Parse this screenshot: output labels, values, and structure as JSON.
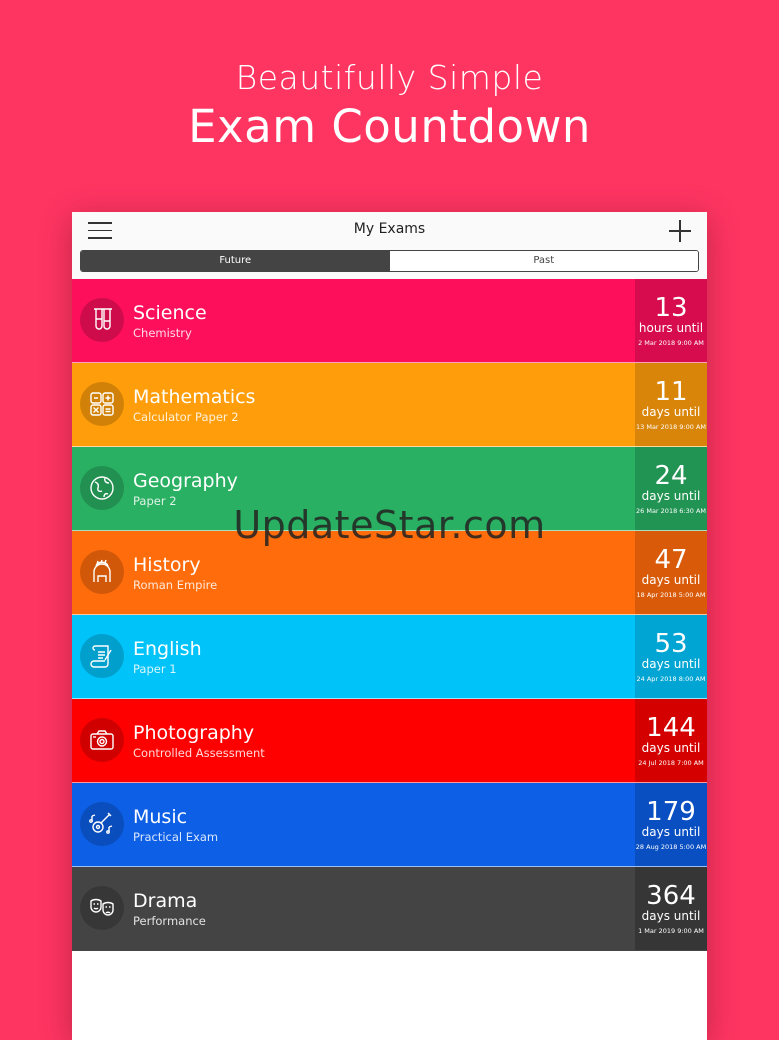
{
  "hero": {
    "line1": "Beautifully Simple",
    "line2": "Exam Countdown"
  },
  "navbar": {
    "title": "My Exams"
  },
  "segments": [
    {
      "label": "Future",
      "active": true
    },
    {
      "label": "Past",
      "active": false
    }
  ],
  "exams": [
    {
      "subject": "Science",
      "detail": "Chemistry",
      "count": "13",
      "unit": "hours until",
      "date": "2 Mar 2018 9:00 AM",
      "color": "#fd0f5c",
      "box_color": "#d60c4f",
      "icon": "test-tubes-icon"
    },
    {
      "subject": "Mathematics",
      "detail": "Calculator Paper 2",
      "count": "11",
      "unit": "days until",
      "date": "13 Mar 2018 9:00 AM",
      "color": "#ff9e0a",
      "box_color": "#d98509",
      "icon": "calculator-icon"
    },
    {
      "subject": "Geography",
      "detail": "Paper 2",
      "count": "24",
      "unit": "days until",
      "date": "26 Mar 2018 6:30 AM",
      "color": "#29b062",
      "box_color": "#219352",
      "icon": "globe-icon"
    },
    {
      "subject": "History",
      "detail": "Roman Empire",
      "count": "47",
      "unit": "days until",
      "date": "18 Apr 2018 5:00 AM",
      "color": "#ff6c0b",
      "box_color": "#d95b09",
      "icon": "roman-helmet-icon"
    },
    {
      "subject": "English",
      "detail": "Paper 1",
      "count": "53",
      "unit": "days until",
      "date": "24 Apr 2018 8:00 AM",
      "color": "#00c3f9",
      "box_color": "#00a5d3",
      "icon": "scroll-quill-icon"
    },
    {
      "subject": "Photography",
      "detail": "Controlled Assessment",
      "count": "144",
      "unit": "days until",
      "date": "24 Jul 2018 7:00 AM",
      "color": "#ff0000",
      "box_color": "#d40000",
      "icon": "camera-icon"
    },
    {
      "subject": "Music",
      "detail": "Practical Exam",
      "count": "179",
      "unit": "days until",
      "date": "28 Aug 2018 5:00 AM",
      "color": "#0d5fe6",
      "box_color": "#0a4fc2",
      "icon": "guitar-notes-icon"
    },
    {
      "subject": "Drama",
      "detail": "Performance",
      "count": "364",
      "unit": "days until",
      "date": "1 Mar 2019 9:00 AM",
      "color": "#444444",
      "box_color": "#363636",
      "icon": "theatre-masks-icon"
    }
  ],
  "watermark": "UpdateStar.com"
}
